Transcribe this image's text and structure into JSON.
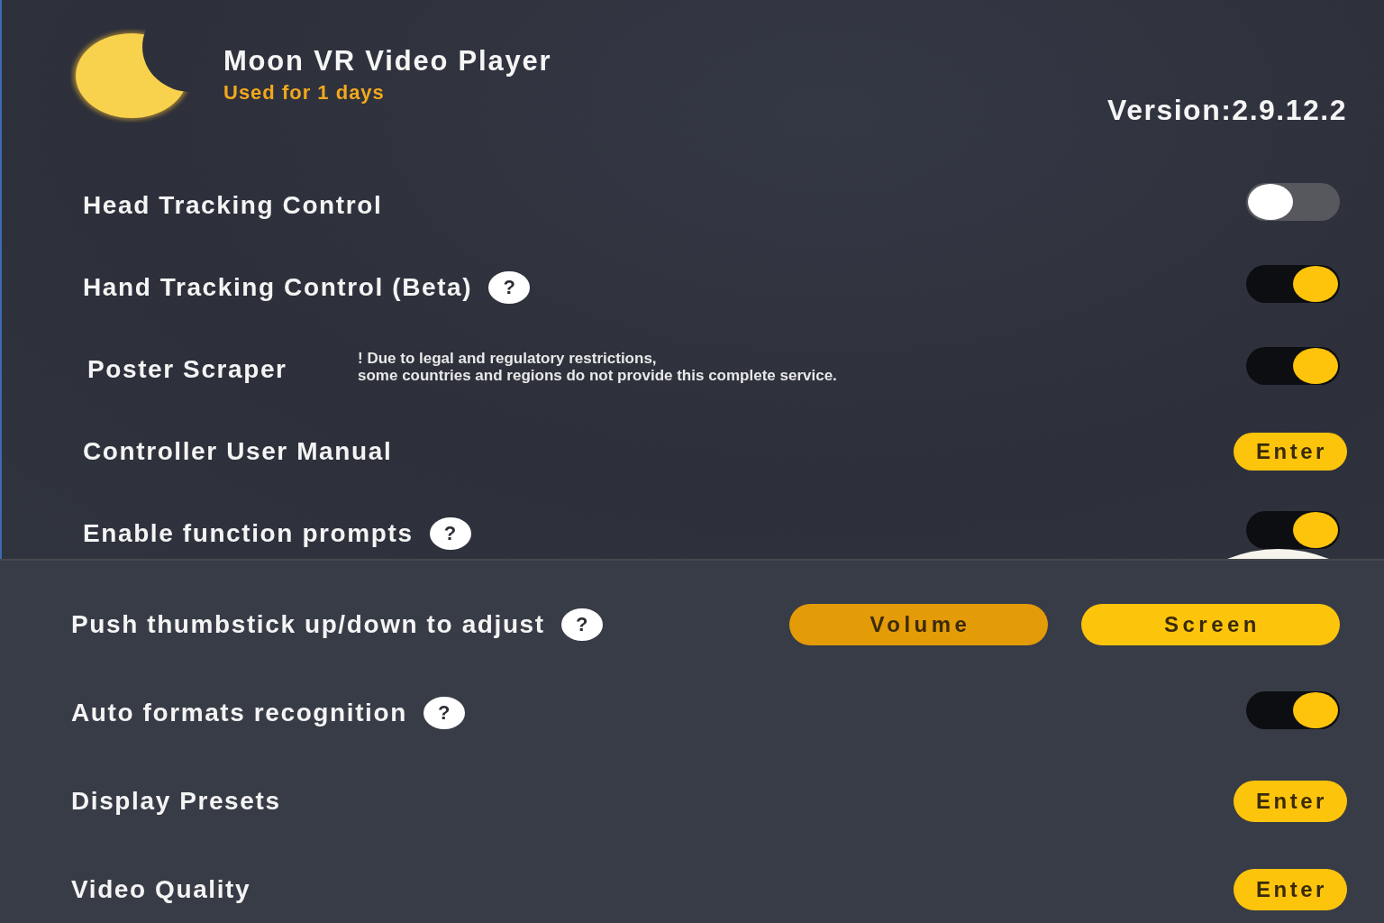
{
  "header": {
    "title": "Moon VR Video Player",
    "usage": "Used for 1 days",
    "version": "Version:2.9.12.2"
  },
  "settings": [
    {
      "kind": "toggle",
      "label": "Head Tracking Control",
      "on": false
    },
    {
      "kind": "toggle",
      "label": "Hand Tracking Control (Beta)",
      "help": "?",
      "on": true
    },
    {
      "kind": "toggle",
      "label": "Poster Scraper",
      "note": [
        "! Due to legal and regulatory restrictions,",
        "some countries and regions do not provide this complete service."
      ],
      "on": true
    },
    {
      "kind": "button",
      "label": "Controller User Manual",
      "button": "Enter"
    },
    {
      "kind": "toggle",
      "label": "Enable function prompts",
      "help": "?",
      "on": true
    }
  ],
  "controls": [
    {
      "kind": "choice",
      "label": "Push thumbstick up/down to adjust",
      "help": "?",
      "options": [
        {
          "label": "Volume",
          "selected": true
        },
        {
          "label": "Screen",
          "selected": false
        }
      ]
    },
    {
      "kind": "toggle",
      "label": "Auto formats recognition",
      "help": "?",
      "on": true
    },
    {
      "kind": "button",
      "label": "Display Presets",
      "button": "Enter"
    },
    {
      "kind": "button",
      "label": "Video Quality",
      "button": "Enter"
    }
  ]
}
